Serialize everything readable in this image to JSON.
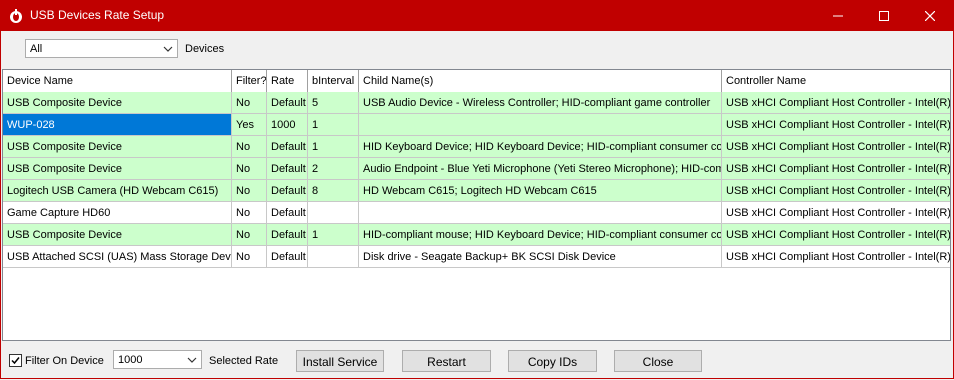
{
  "window": {
    "title": "USB Devices Rate Setup",
    "accent_color": "#c00000"
  },
  "toolbar": {
    "filter_value": "All",
    "devices_label": "Devices"
  },
  "table": {
    "columns": [
      "Device Name",
      "Filter?",
      "Rate",
      "bInterval",
      "Child Name(s)",
      "Controller Name"
    ],
    "row_colors": {
      "filtered": "#ccffcc",
      "unfiltered": "#ffffff",
      "selected": "#0078d7"
    },
    "rows": [
      {
        "cells": [
          "USB Composite Device",
          "No",
          "Default",
          "5",
          "USB Audio Device - Wireless Controller; HID-compliant game controller",
          "USB xHCI Compliant Host Controller - Intel(R) US"
        ],
        "color": "green",
        "selected": false
      },
      {
        "cells": [
          "WUP-028",
          "Yes",
          "1000",
          "1",
          "",
          "USB xHCI Compliant Host Controller - Intel(R) US"
        ],
        "color": "green",
        "selected": true
      },
      {
        "cells": [
          "USB Composite Device",
          "No",
          "Default",
          "1",
          "HID Keyboard Device; HID Keyboard Device; HID-compliant consumer cont",
          "USB xHCI Compliant Host Controller - Intel(R) US"
        ],
        "color": "green",
        "selected": false
      },
      {
        "cells": [
          "USB Composite Device",
          "No",
          "Default",
          "2",
          "Audio Endpoint - Blue Yeti Microphone (Yeti Stereo Microphone); HID-compl",
          "USB xHCI Compliant Host Controller - Intel(R) US"
        ],
        "color": "green",
        "selected": false
      },
      {
        "cells": [
          "Logitech USB Camera (HD Webcam C615)",
          "No",
          "Default",
          "8",
          "HD Webcam C615; Logitech HD Webcam C615",
          "USB xHCI Compliant Host Controller - Intel(R) US"
        ],
        "color": "green",
        "selected": false
      },
      {
        "cells": [
          "Game Capture HD60",
          "No",
          "Default",
          "",
          "",
          "USB xHCI Compliant Host Controller - Intel(R) US"
        ],
        "color": "white",
        "selected": false
      },
      {
        "cells": [
          "USB Composite Device",
          "No",
          "Default",
          "1",
          "HID-compliant mouse; HID Keyboard Device; HID-compliant consumer cont",
          "USB xHCI Compliant Host Controller - Intel(R) US"
        ],
        "color": "green",
        "selected": false
      },
      {
        "cells": [
          "USB Attached SCSI (UAS) Mass Storage Devic",
          "No",
          "Default",
          "",
          "Disk drive - Seagate Backup+  BK SCSI Disk Device",
          "USB xHCI Compliant Host Controller - Intel(R) US"
        ],
        "color": "white",
        "selected": false
      }
    ]
  },
  "footer": {
    "filter_on_device_label": "Filter On Device",
    "filter_on_device_checked": true,
    "rate_value": "1000",
    "selected_rate_label": "Selected Rate",
    "install_label": "Install Service",
    "restart_label": "Restart",
    "copy_label": "Copy IDs",
    "close_label": "Close"
  }
}
